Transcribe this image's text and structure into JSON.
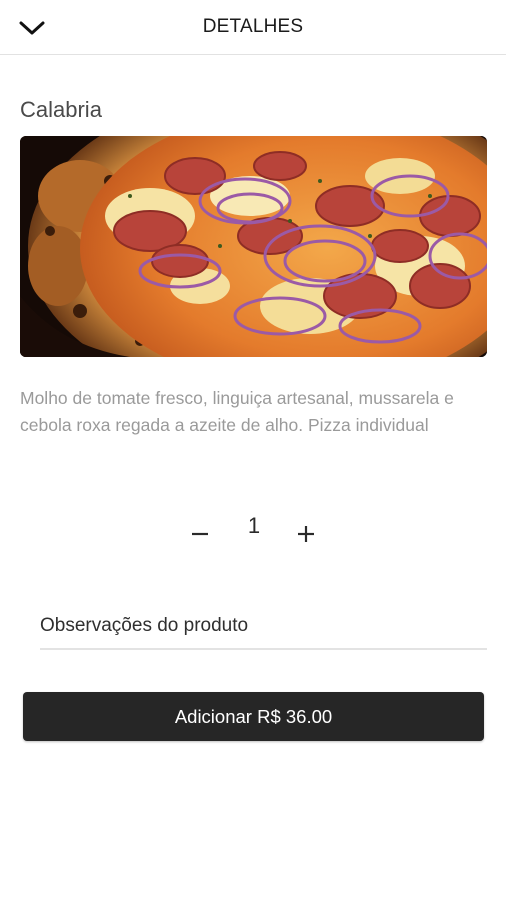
{
  "header": {
    "title": "DETALHES",
    "back_icon": "chevron-down-icon"
  },
  "product": {
    "name": "Calabria",
    "image_icon": "pizza-photo",
    "description": "Molho de tomate fresco, linguiça artesanal, mussarela e cebola roxa regada a azeite de alho. Pizza individual"
  },
  "quantity": {
    "value": "1",
    "minus_label": "−",
    "plus_label": "+"
  },
  "notes": {
    "placeholder": "Observações do produto",
    "value": ""
  },
  "add_button": {
    "label": "Adicionar R$ 36.00"
  },
  "colors": {
    "button_bg": "#262626",
    "description_text": "#9a9a9a",
    "divider": "#e2e2e2"
  }
}
